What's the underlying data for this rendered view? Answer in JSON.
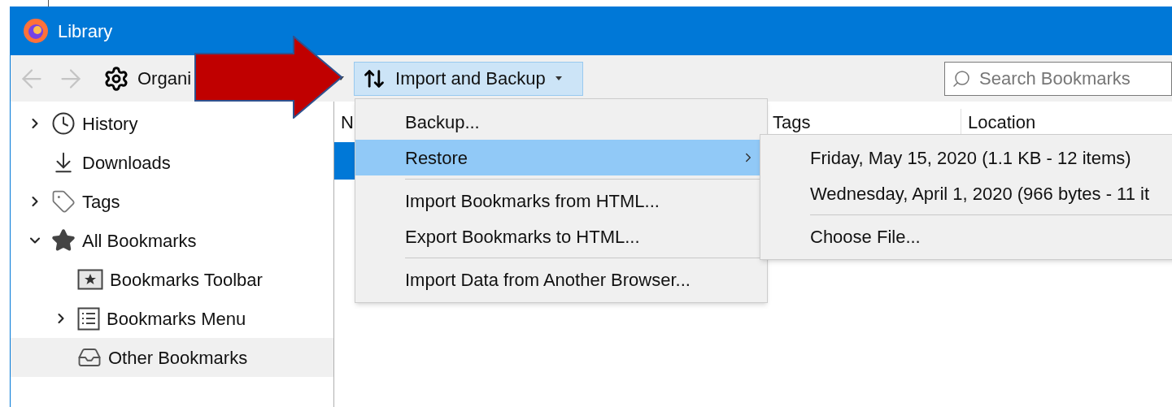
{
  "window": {
    "title": "Library"
  },
  "toolbar": {
    "organize": {
      "label": "Organi"
    },
    "import_backup": {
      "label": "Import and Backup",
      "selected": true
    },
    "search": {
      "placeholder": "Search Bookmarks"
    }
  },
  "sidebar": {
    "items": [
      {
        "label": "History",
        "expanded": false,
        "selected": false
      },
      {
        "label": "Downloads",
        "selected": false
      },
      {
        "label": "Tags",
        "expanded": false,
        "selected": false
      },
      {
        "label": "All Bookmarks",
        "expanded": true,
        "selected": false,
        "children": [
          {
            "label": "Bookmarks Toolbar",
            "selected": false
          },
          {
            "label": "Bookmarks Menu",
            "expanded": false,
            "selected": false
          },
          {
            "label": "Other Bookmarks",
            "selected": true
          }
        ]
      }
    ]
  },
  "table": {
    "columns": [
      "N",
      "Tags",
      "Location"
    ],
    "rows": [
      {
        "selected": true
      }
    ]
  },
  "menu": {
    "items": [
      {
        "kind": "item",
        "label": "Backup...",
        "selected": false,
        "submenu": false
      },
      {
        "kind": "item",
        "label": "Restore",
        "selected": true,
        "submenu": true
      },
      {
        "kind": "separator"
      },
      {
        "kind": "item",
        "label": "Import Bookmarks from HTML...",
        "selected": false,
        "submenu": false
      },
      {
        "kind": "item",
        "label": "Export Bookmarks to HTML...",
        "selected": false,
        "submenu": false
      },
      {
        "kind": "separator"
      },
      {
        "kind": "item",
        "label": "Import Data from Another Browser...",
        "selected": false,
        "submenu": false
      }
    ]
  },
  "submenu": {
    "items": [
      {
        "kind": "item",
        "label": "Friday, May 15, 2020 (1.1 KB - 12 items)",
        "selected": false
      },
      {
        "kind": "item",
        "label": "Wednesday, April 1, 2020 (966 bytes - 11 it",
        "selected": false
      },
      {
        "kind": "separator"
      },
      {
        "kind": "item",
        "label": "Choose File...",
        "selected": false
      }
    ]
  }
}
